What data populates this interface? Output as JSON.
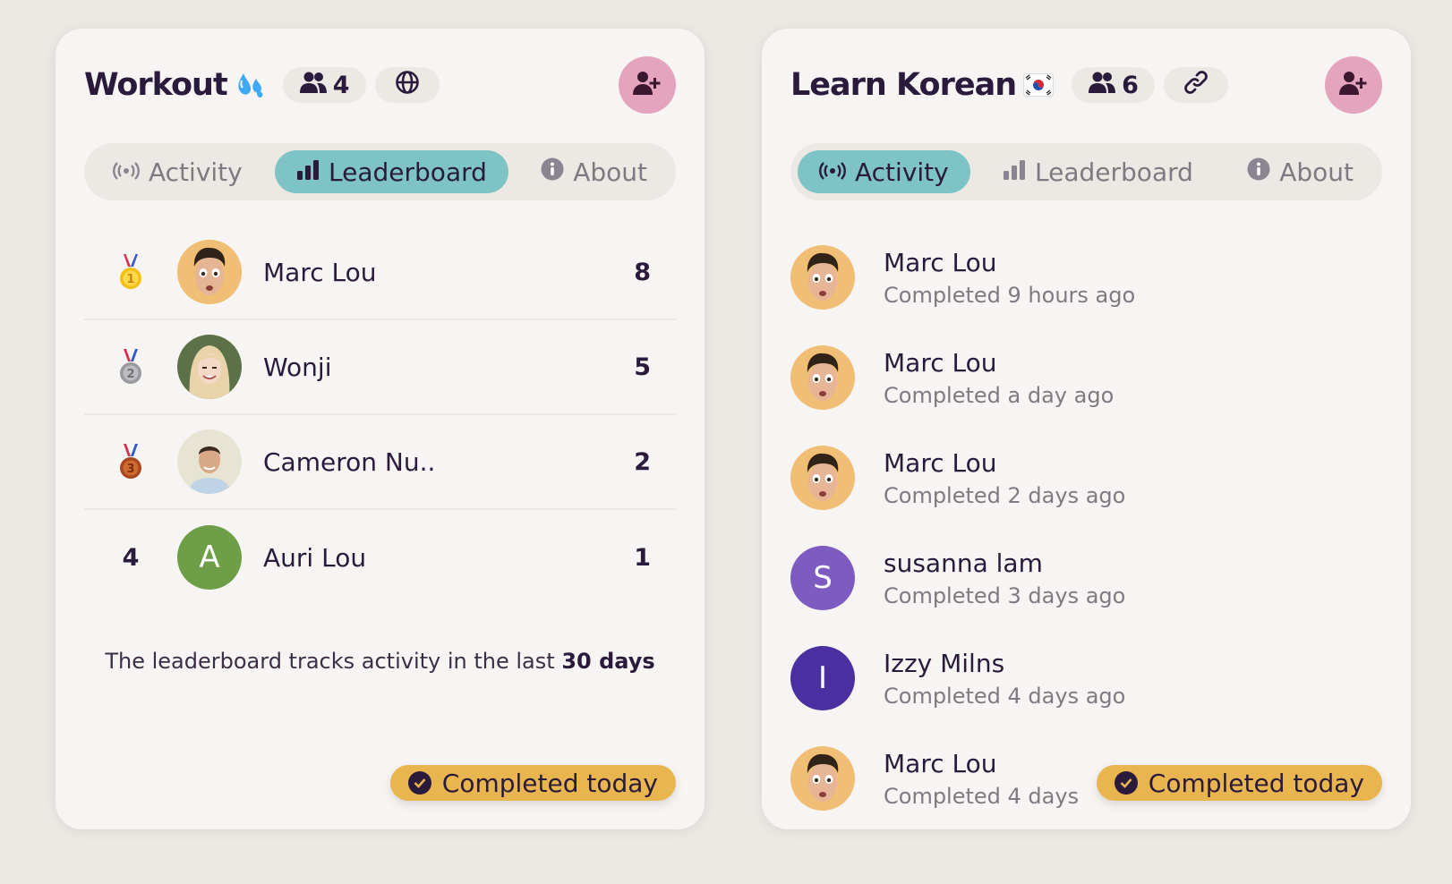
{
  "cards": [
    {
      "title": "Workout",
      "title_emoji": "sweat-droplets",
      "member_count": "4",
      "visibility_icon": "globe-icon",
      "tabs": [
        {
          "label": "Activity",
          "icon": "broadcast-icon"
        },
        {
          "label": "Leaderboard",
          "icon": "bar-chart-icon"
        },
        {
          "label": "About",
          "icon": "info-icon"
        }
      ],
      "active_tab": "Leaderboard",
      "leaderboard": [
        {
          "rank": "1",
          "medal": "gold",
          "name": "Marc Lou",
          "score": "8"
        },
        {
          "rank": "2",
          "medal": "silver",
          "name": "Wonji",
          "score": "5"
        },
        {
          "rank": "3",
          "medal": "bronze",
          "name": "Cameron Nu..",
          "score": "2"
        },
        {
          "rank": "4",
          "medal": "",
          "name": "Auri Lou",
          "score": "1",
          "avatar_letter": "A",
          "avatar_color": "#6E9E48"
        }
      ],
      "footer_text": "The leaderboard tracks activity in the last",
      "footer_bold": "30 days",
      "status_badge": "Completed today"
    },
    {
      "title": "Learn Korean",
      "title_emoji": "south-korea-flag",
      "member_count": "6",
      "visibility_icon": "link-icon",
      "tabs": [
        {
          "label": "Activity",
          "icon": "broadcast-icon"
        },
        {
          "label": "Leaderboard",
          "icon": "bar-chart-icon"
        },
        {
          "label": "About",
          "icon": "info-icon"
        }
      ],
      "active_tab": "Activity",
      "activity": [
        {
          "name": "Marc Lou",
          "status": "Completed 9 hours ago"
        },
        {
          "name": "Marc Lou",
          "status": "Completed a day ago"
        },
        {
          "name": "Marc Lou",
          "status": "Completed 2 days ago"
        },
        {
          "name": "susanna lam",
          "status": "Completed 3 days ago",
          "avatar_letter": "S",
          "avatar_color": "#7D5BC0"
        },
        {
          "name": "Izzy Milns",
          "status": "Completed 4 days ago",
          "avatar_letter": "I",
          "avatar_color": "#4A2FA0"
        },
        {
          "name": "Marc Lou",
          "status": "Completed 4 days"
        }
      ],
      "status_badge": "Completed today"
    }
  ],
  "colors": {
    "background": "#ECE9E4",
    "card": "#F7F5F3",
    "active_tab": "#7EC3C6",
    "invite_button": "#E4A4BE",
    "completed_badge": "#E8B54F",
    "text": "#2A1B3D"
  }
}
